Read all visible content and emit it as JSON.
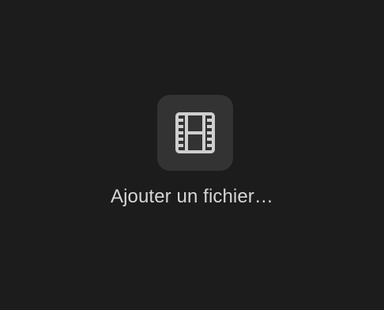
{
  "add_file": {
    "label": "Ajouter un fichier…",
    "icon": "film-strip-icon"
  },
  "colors": {
    "background": "#1c1c1c",
    "tile": "#333333",
    "icon": "#cfcfcf",
    "text": "#d6d6d6"
  }
}
